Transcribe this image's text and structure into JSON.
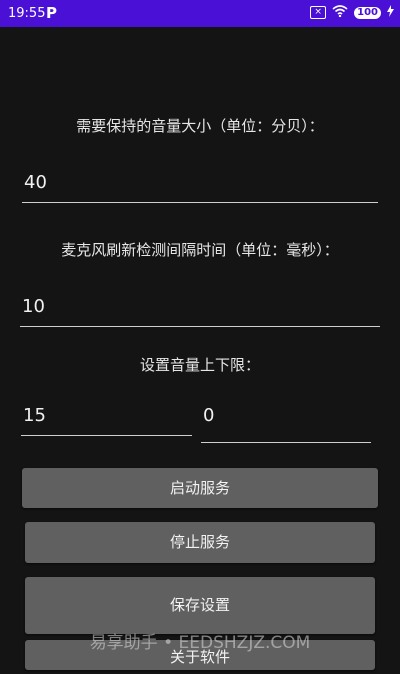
{
  "status_bar": {
    "time": "19:55",
    "app_glyph": "P",
    "battery": "100",
    "icons": [
      "notification-x-icon",
      "wifi-icon",
      "battery-icon",
      "charging-icon"
    ]
  },
  "form": {
    "volume_label": "需要保持的音量大小（单位：分贝）：",
    "volume_value": "40",
    "interval_label": "麦克风刷新检测间隔时间（单位：毫秒）：",
    "interval_value": "10",
    "limit_label": "设置音量上下限：",
    "limit_upper": "15",
    "limit_lower": "0"
  },
  "buttons": {
    "start": "启动服务",
    "stop": "停止服务",
    "save": "保存设置",
    "about": "关于软件"
  },
  "watermark": "易享助手 • EEDSHZJZ.COM",
  "colors": {
    "status_bar": "#4a10d6",
    "background": "#141414",
    "button": "#606060"
  }
}
